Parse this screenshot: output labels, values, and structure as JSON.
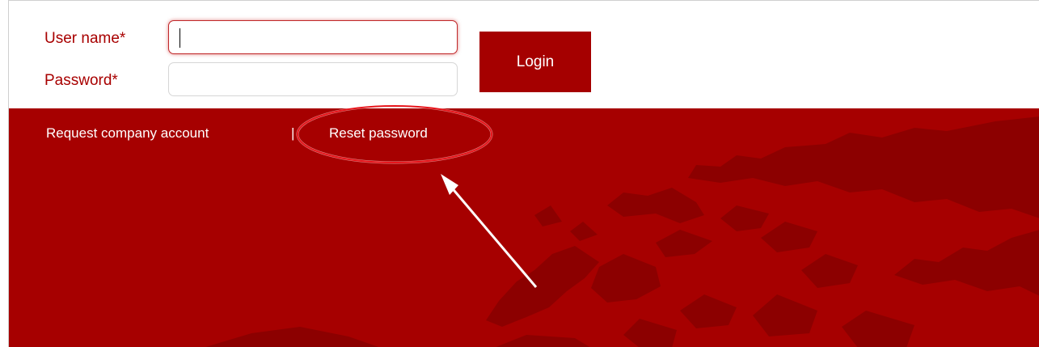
{
  "login_form": {
    "username_label": "User name*",
    "username_value": "",
    "password_label": "Password*",
    "password_value": "",
    "login_button": "Login"
  },
  "footer_links": {
    "request_account": "Request company account",
    "separator": "|",
    "reset_password": "Reset password"
  },
  "colors": {
    "brand_red": "#a60000",
    "map_dark_red": "#8c0000",
    "label_red": "#a80000",
    "annotation": "#ffffff"
  },
  "annotation": {
    "highlight": "Reset password",
    "shape": "ellipse-with-arrow"
  }
}
